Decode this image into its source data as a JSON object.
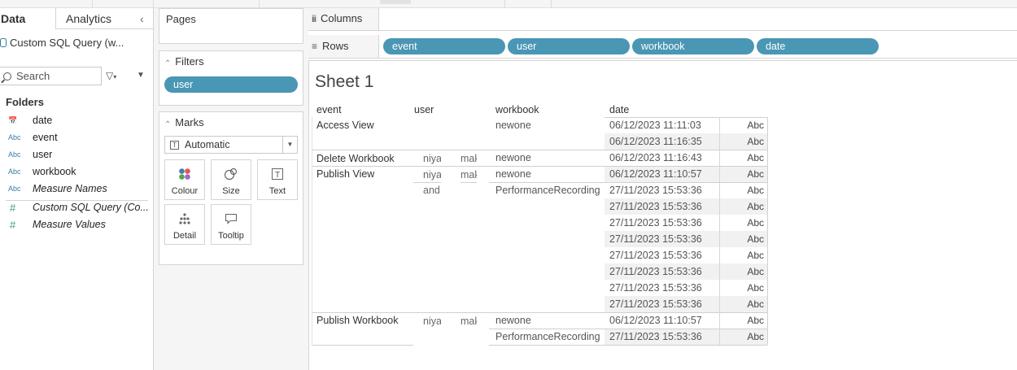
{
  "pane": {
    "tab_data": "Data",
    "tab_analytics": "Analytics",
    "collapse_icon": "chevron-left-icon",
    "datasource": "Custom SQL Query (w...",
    "search_placeholder": "Search",
    "folders_title": "Folders",
    "fields": [
      {
        "type": "date",
        "icon": "Abc",
        "label": "date"
      },
      {
        "type": "string",
        "icon": "Abc",
        "label": "event"
      },
      {
        "type": "string",
        "icon": "Abc",
        "label": "user"
      },
      {
        "type": "string",
        "icon": "Abc",
        "label": "workbook"
      },
      {
        "type": "string",
        "icon": "Abc",
        "label": "Measure Names"
      },
      {
        "type": "number",
        "icon": "#",
        "label": "Custom SQL Query (Co..."
      },
      {
        "type": "number",
        "icon": "#",
        "label": "Measure Values"
      }
    ]
  },
  "cards": {
    "pages_title": "Pages",
    "filters_title": "Filters",
    "filter_pill": "user",
    "marks_title": "Marks",
    "mark_type": "Automatic",
    "mark_buttons": [
      "Colour",
      "Size",
      "Text",
      "Detail",
      "Tooltip"
    ]
  },
  "shelves": {
    "columns_label": "Columns",
    "rows_label": "Rows",
    "row_pills": [
      "event",
      "user",
      "workbook",
      "date"
    ]
  },
  "view": {
    "sheet_title": "Sheet 1",
    "headers": [
      "event",
      "user",
      "workbook",
      "date"
    ],
    "events": [
      "Access View",
      "Delete Workbook",
      "Publish View",
      "Publish Workbook"
    ],
    "user_fragments": [
      "niya",
      "mak",
      "and"
    ],
    "workbooks": [
      "newone",
      "newone",
      "newone",
      "PerformanceRecording",
      "newone",
      "PerformanceRecording"
    ],
    "dates": [
      "06/12/2023 11:11:03",
      "06/12/2023 11:16:35",
      "06/12/2023 11:16:43",
      "06/12/2023 11:10:57",
      "27/11/2023 15:53:36",
      "27/11/2023 15:53:36",
      "27/11/2023 15:53:36",
      "27/11/2023 15:53:36",
      "27/11/2023 15:53:36",
      "27/11/2023 15:53:36",
      "27/11/2023 15:53:36",
      "27/11/2023 15:53:36",
      "06/12/2023 11:10:57",
      "27/11/2023 15:53:36"
    ],
    "abc": "Abc"
  }
}
